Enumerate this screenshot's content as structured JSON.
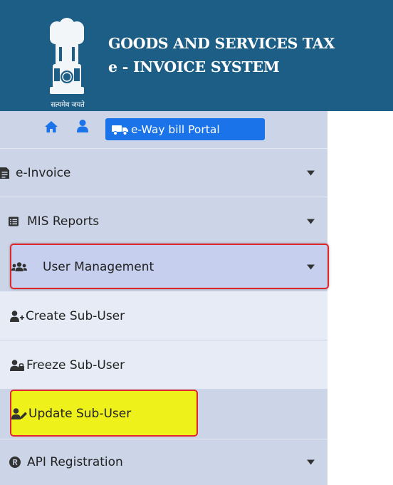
{
  "header": {
    "title_line1": "GOODS AND SERVICES TAX",
    "title_line2": "e - INVOICE SYSTEM",
    "emblem_caption": "सत्यमेव जयते",
    "background_color": "#1d5e87"
  },
  "topbar": {
    "home_icon": "home-icon",
    "user_icon": "user-icon",
    "portal_button_label": "e-Way bill Portal",
    "portal_button_icon": "truck-icon",
    "portal_button_color": "#1a73e8"
  },
  "sidebar": {
    "items": [
      {
        "label": "e-Invoice",
        "icon": "document-icon",
        "has_caret": true
      },
      {
        "label": "MIS Reports",
        "icon": "list-icon",
        "has_caret": true
      },
      {
        "label": "User Management",
        "icon": "users-icon",
        "has_caret": true,
        "highlighted": true
      },
      {
        "label": "Create Sub-User",
        "icon": "user-plus-icon",
        "submenu": true
      },
      {
        "label": "Freeze Sub-User",
        "icon": "user-lock-icon",
        "submenu": true
      },
      {
        "label": "Update Sub-User",
        "icon": "user-edit-icon",
        "submenu": true,
        "highlighted": true
      },
      {
        "label": "API Registration",
        "icon": "registered-icon",
        "has_caret": true
      }
    ]
  },
  "colors": {
    "sidebar_bg": "#ccd5e7",
    "submenu_bg": "#e6ebf5",
    "highlight_border": "#e0262b",
    "highlight_yellow": "#eff11a"
  }
}
